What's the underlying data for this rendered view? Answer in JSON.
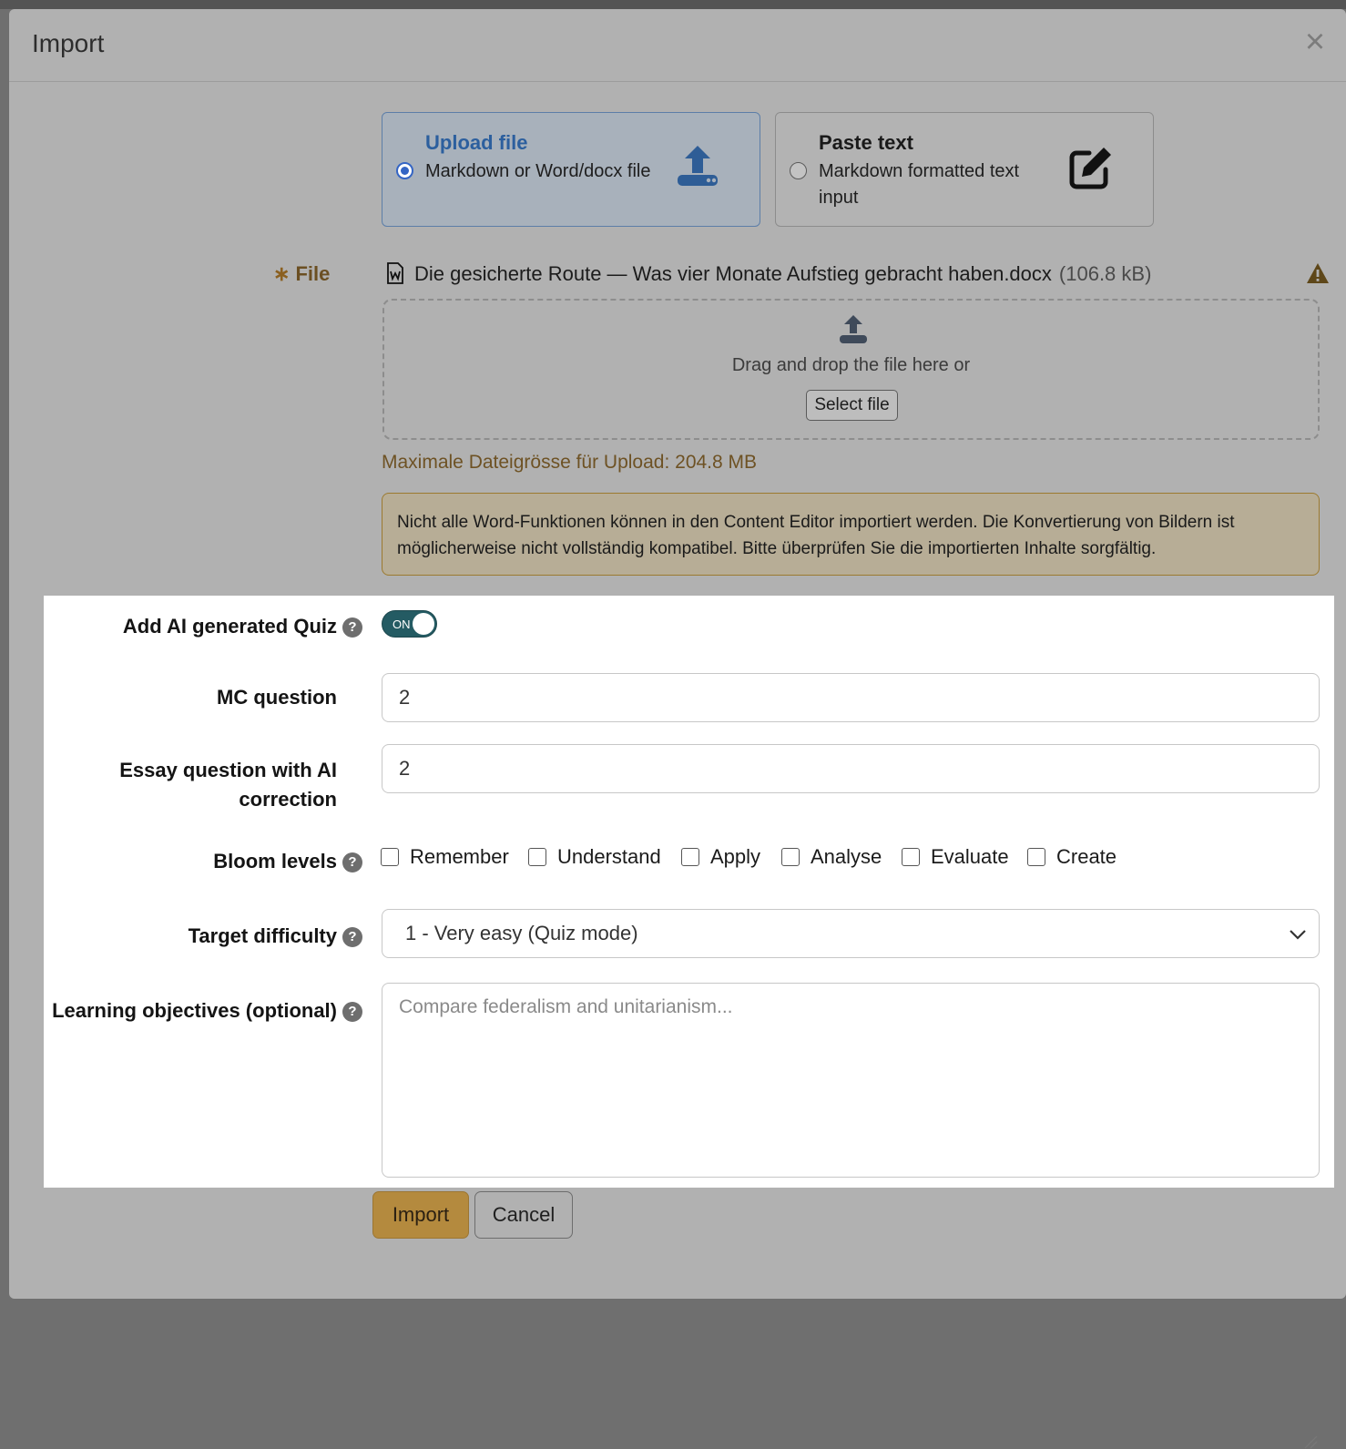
{
  "dialog": {
    "title": "Import",
    "close_label": "×"
  },
  "import_modes": [
    {
      "title": "Upload file",
      "description": "Markdown or Word/docx file",
      "icon": "upload-icon",
      "selected": true
    },
    {
      "title": "Paste text",
      "description": "Markdown formatted text input",
      "icon": "edit-icon",
      "selected": false
    }
  ],
  "file_field": {
    "required_marker": "∗",
    "label": "File",
    "file_name": "Die gesicherte Route — Was vier Monate Aufstieg gebracht haben.docx",
    "file_size": "(106.8 kB)",
    "dropzone_text": "Drag and drop the file here or",
    "select_button": "Select file",
    "max_size_text": "Maximale Dateigrösse für Upload: 204.8 MB",
    "notice": "Nicht alle Word-Funktionen können in den Content Editor importiert werden. Die Konvertierung von Bildern ist möglicherweise nicht vollständig kompatibel. Bitte überprüfen Sie die importierten Inhalte sorgfältig."
  },
  "quiz": {
    "add_ai_quiz_label": "Add AI generated Quiz",
    "toggle_text": "ON",
    "mc_label": "MC question",
    "mc_value": "2",
    "essay_label_line1": "Essay question with AI",
    "essay_label_line2": "correction",
    "essay_value": "2",
    "bloom_label": "Bloom levels",
    "bloom_levels": [
      "Remember",
      "Understand",
      "Apply",
      "Analyse",
      "Evaluate",
      "Create"
    ],
    "difficulty_label": "Target difficulty",
    "difficulty_value": "1 - Very easy (Quiz mode)",
    "objectives_label": "Learning objectives (optional)",
    "objectives_placeholder": "Compare federalism and unitarianism..."
  },
  "help_glyph": "?",
  "buttons": {
    "import": "Import",
    "cancel": "Cancel"
  },
  "colors": {
    "accent_blue": "#3465c4",
    "toggle_on": "#245b63",
    "import_button": "#b48a3e"
  }
}
